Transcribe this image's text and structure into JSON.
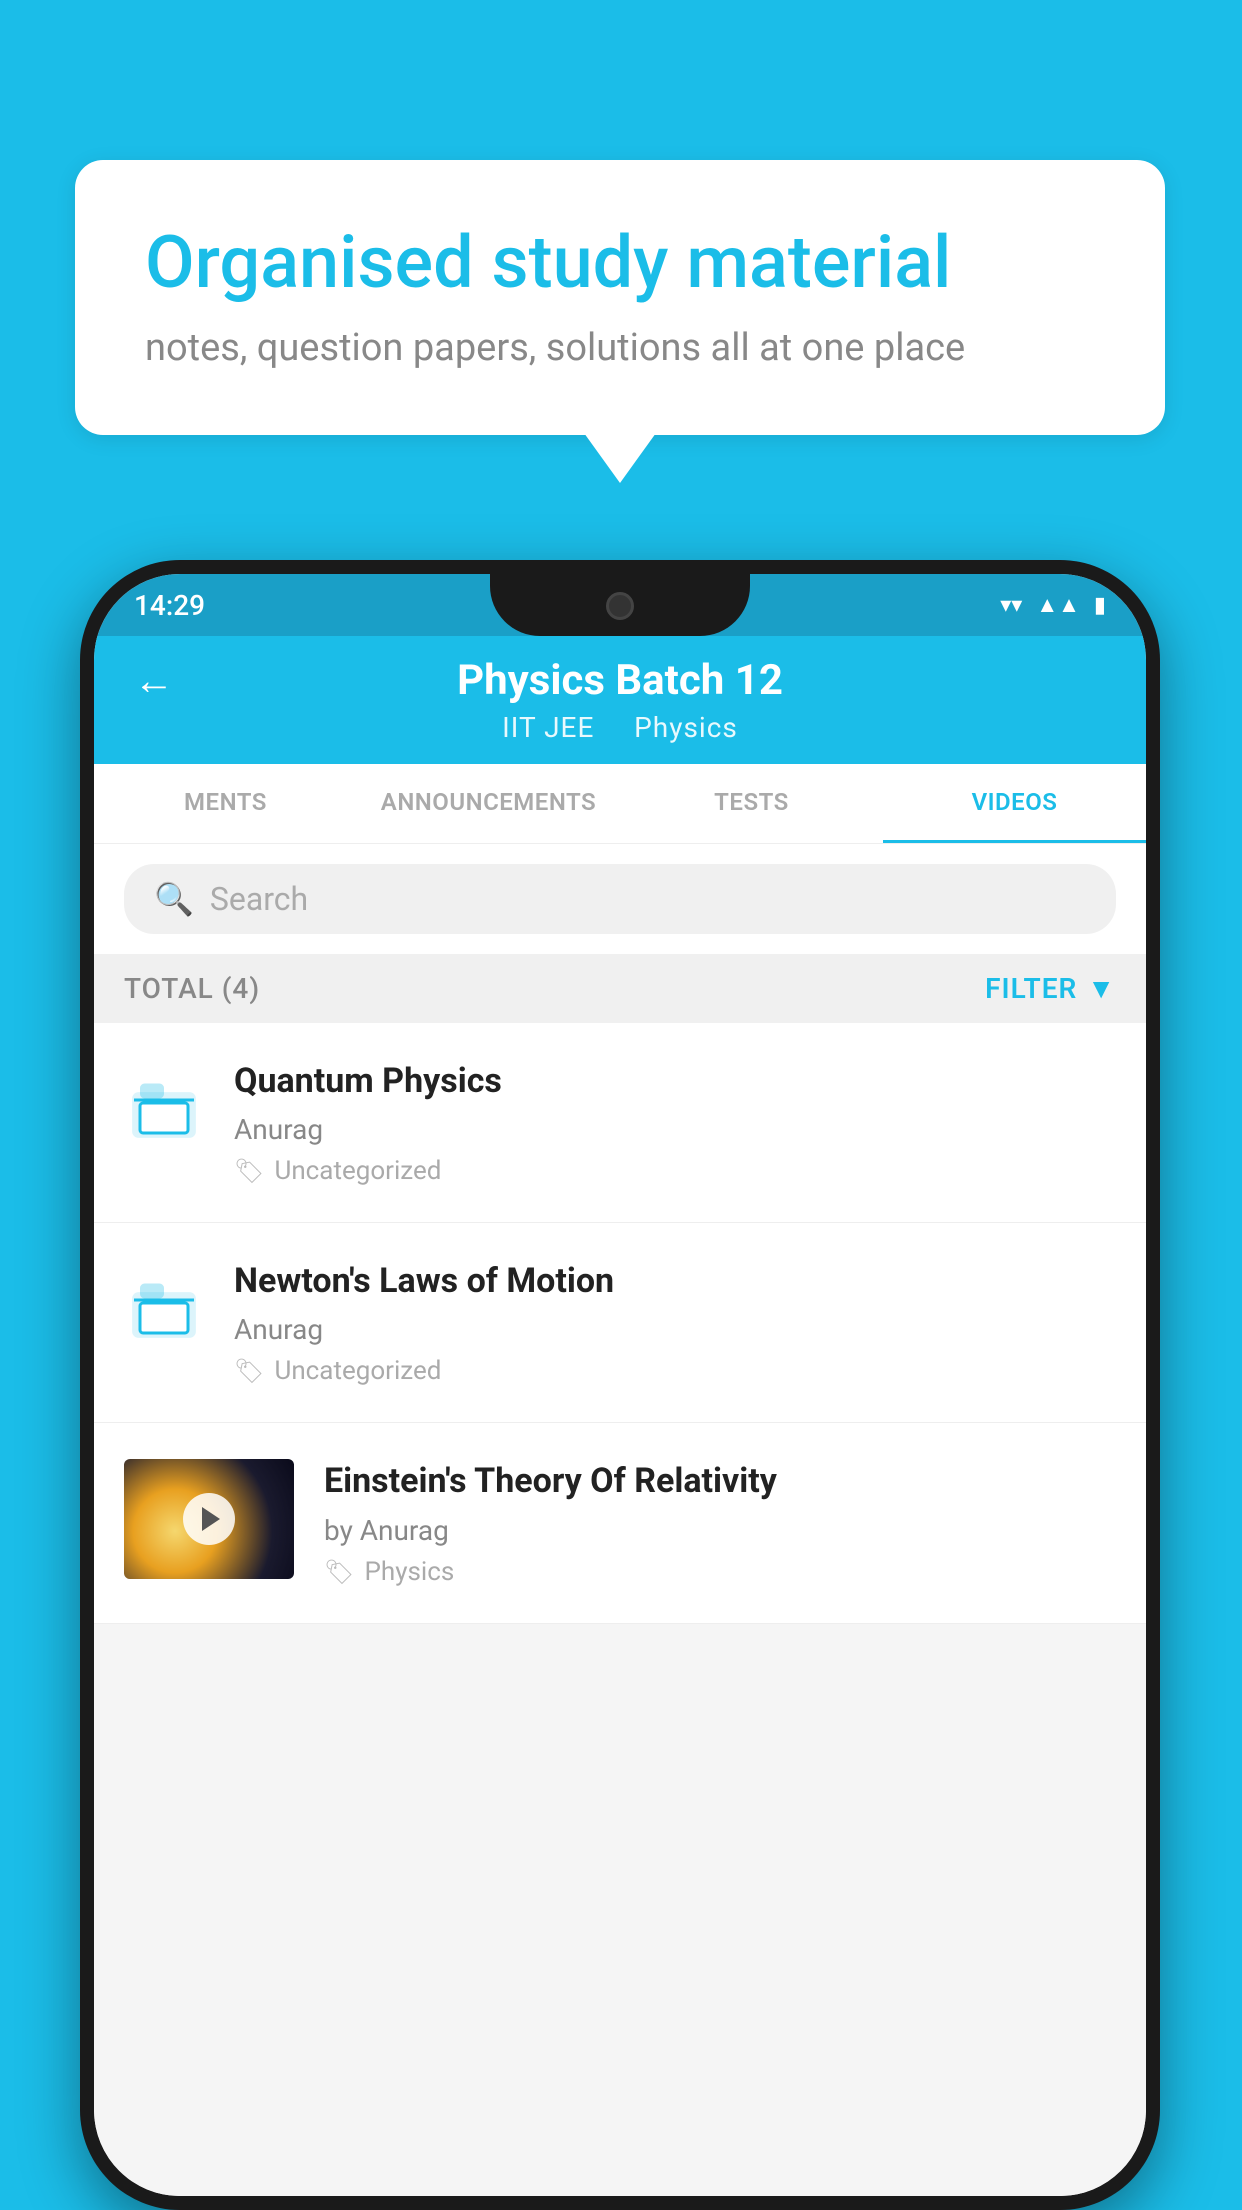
{
  "background_color": "#1bbde8",
  "bubble": {
    "title": "Organised study material",
    "subtitle": "notes, question papers, solutions all at one place"
  },
  "status_bar": {
    "time": "14:29",
    "icons": [
      "wifi",
      "signal",
      "battery"
    ]
  },
  "header": {
    "title": "Physics Batch 12",
    "subtitle_part1": "IIT JEE",
    "subtitle_part2": "Physics",
    "back_label": "←"
  },
  "tabs": [
    {
      "id": "ments",
      "label": "MENTS",
      "active": false
    },
    {
      "id": "announcements",
      "label": "ANNOUNCEMENTS",
      "active": false
    },
    {
      "id": "tests",
      "label": "TESTS",
      "active": false
    },
    {
      "id": "videos",
      "label": "VIDEOS",
      "active": true
    }
  ],
  "search": {
    "placeholder": "Search"
  },
  "filter_bar": {
    "total_label": "TOTAL (4)",
    "filter_label": "FILTER"
  },
  "videos": [
    {
      "id": "quantum",
      "title": "Quantum Physics",
      "author": "Anurag",
      "tag": "Uncategorized",
      "type": "folder",
      "has_thumbnail": false
    },
    {
      "id": "newton",
      "title": "Newton's Laws of Motion",
      "author": "Anurag",
      "tag": "Uncategorized",
      "type": "folder",
      "has_thumbnail": false
    },
    {
      "id": "einstein",
      "title": "Einstein's Theory Of Relativity",
      "author": "by Anurag",
      "tag": "Physics",
      "type": "video",
      "has_thumbnail": true
    }
  ]
}
